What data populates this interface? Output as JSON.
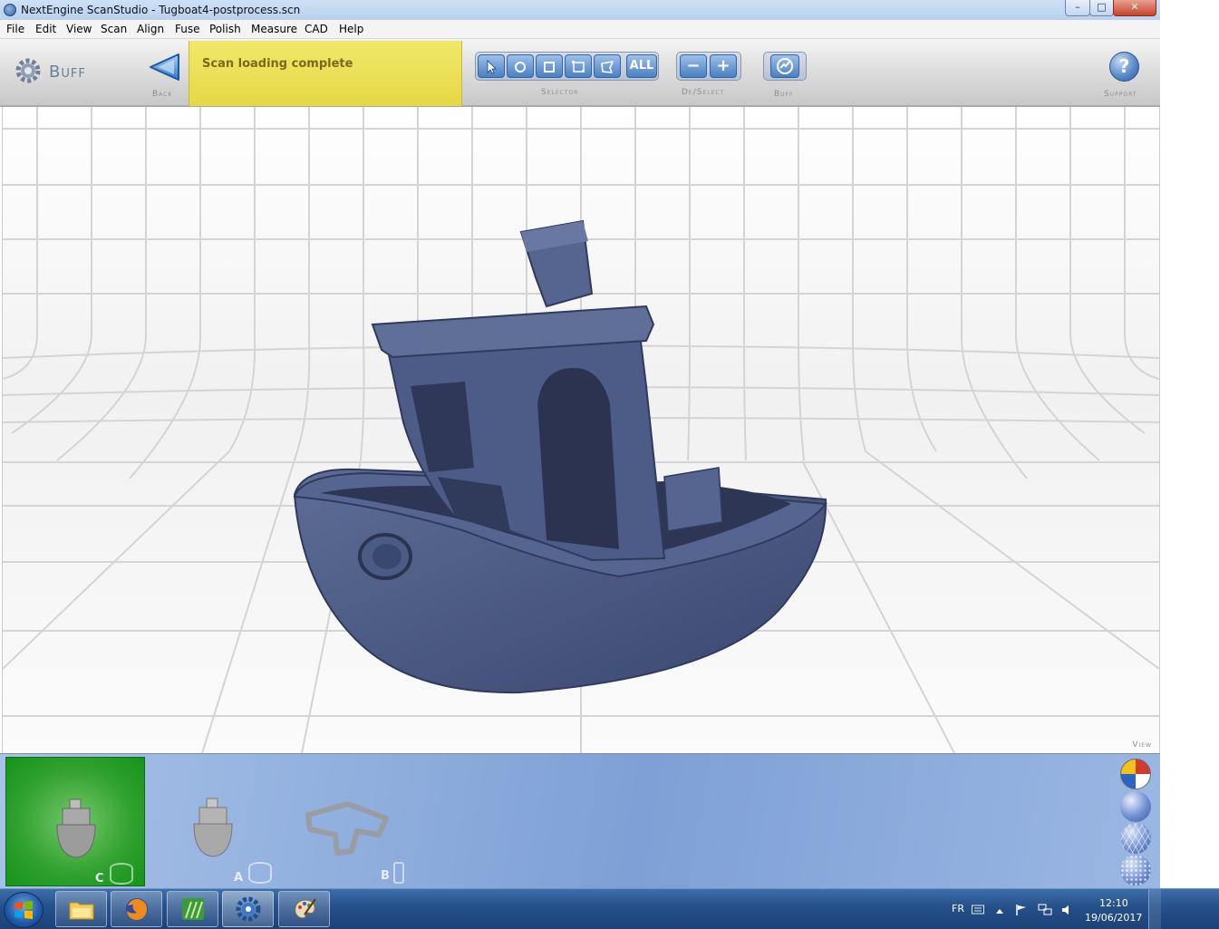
{
  "window": {
    "title": "NextEngine ScanStudio - Tugboat4-postprocess.scn",
    "controls": {
      "minimize": "–",
      "maximize": "□",
      "close": "✕"
    }
  },
  "menu": [
    "File",
    "Edit",
    "View",
    "Scan",
    "Align",
    "Fuse",
    "Polish",
    "Measure",
    "CAD",
    "Help"
  ],
  "toolbar": {
    "mode_title": "Buff",
    "back_label": "Back",
    "status": "Scan loading complete",
    "selector_label": "Selector",
    "selector_all": "ALL",
    "deselect_label": "De/Select",
    "deselect_minus": "−",
    "deselect_plus": "+",
    "buff_label": "Buff",
    "support_label": "Support",
    "support_icon": "?"
  },
  "viewport": {
    "label": "View"
  },
  "scans": [
    {
      "letter": "C",
      "active": true
    },
    {
      "letter": "A",
      "active": false
    },
    {
      "letter": "B",
      "active": false
    }
  ],
  "taskbar": {
    "lang": "FR",
    "time": "12:10",
    "date": "19/06/2017"
  },
  "colors": {
    "model": "#4b5b84",
    "status_bg": "#ece058",
    "tray_active": "#2fa02e",
    "accent": "#4a7fc2"
  }
}
